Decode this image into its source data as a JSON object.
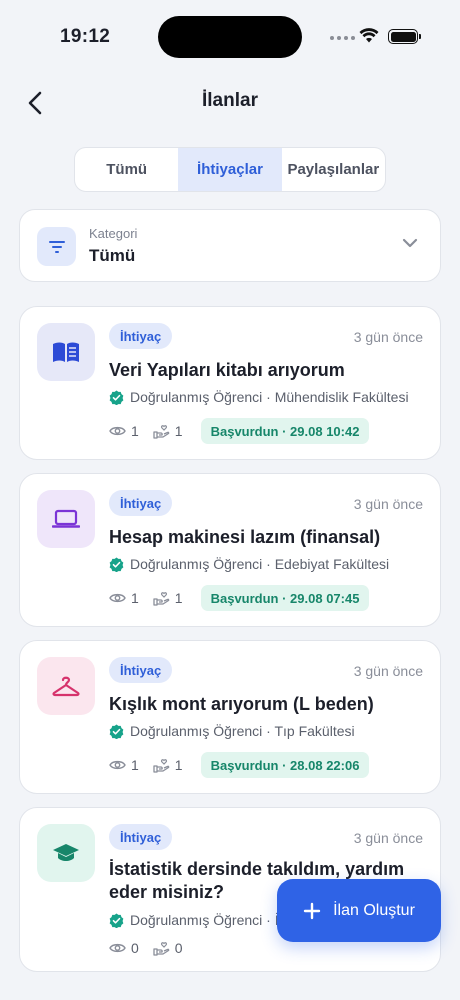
{
  "status_bar": {
    "time": "19:12"
  },
  "header": {
    "title": "İlanlar"
  },
  "tabs": [
    {
      "label": "Tümü",
      "active": false
    },
    {
      "label": "İhtiyaçlar",
      "active": true
    },
    {
      "label": "Paylaşılanlar",
      "active": false
    }
  ],
  "category": {
    "label": "Kategori",
    "value": "Tümü"
  },
  "listings": [
    {
      "badge": "İhtiyaç",
      "time": "3 gün önce",
      "title": "Veri Yapıları kitabı arıyorum",
      "meta": "Doğrulanmış Öğrenci · Mühendislik Fakültesi",
      "views": "1",
      "offers": "1",
      "status": "Başvurdun · 29.08 10:42",
      "icon": "book-icon",
      "icon_bg": "#e6e8f8",
      "icon_color": "#2d4bd6"
    },
    {
      "badge": "İhtiyaç",
      "time": "3 gün önce",
      "title": "Hesap makinesi lazım (finansal)",
      "meta": "Doğrulanmış Öğrenci · Edebiyat Fakültesi",
      "views": "1",
      "offers": "1",
      "status": "Başvurdun · 29.08 07:45",
      "icon": "laptop-icon",
      "icon_bg": "#efe6fa",
      "icon_color": "#7b34d6"
    },
    {
      "badge": "İhtiyaç",
      "time": "3 gün önce",
      "title": "Kışlık mont arıyorum (L beden)",
      "meta": "Doğrulanmış Öğrenci · Tıp Fakültesi",
      "views": "1",
      "offers": "1",
      "status": "Başvurdun · 28.08 22:06",
      "icon": "hanger-icon",
      "icon_bg": "#fbe6ee",
      "icon_color": "#d6336c"
    },
    {
      "badge": "İhtiyaç",
      "time": "3 gün önce",
      "title": "İstatistik dersinde takıldım, yardım eder misiniz?",
      "meta": "Doğrulanmış Öğrenci · İktisat Fakültesi",
      "views": "0",
      "offers": "0",
      "status": "",
      "icon": "graduation-cap-icon",
      "icon_bg": "#e1f5ee",
      "icon_color": "#17866a"
    }
  ],
  "fab": {
    "label": "İlan Oluştur"
  },
  "colors": {
    "accent": "#2f63e6",
    "verified": "#17a38a",
    "applied_bg": "#e1f5ee",
    "applied_text": "#17866a"
  }
}
